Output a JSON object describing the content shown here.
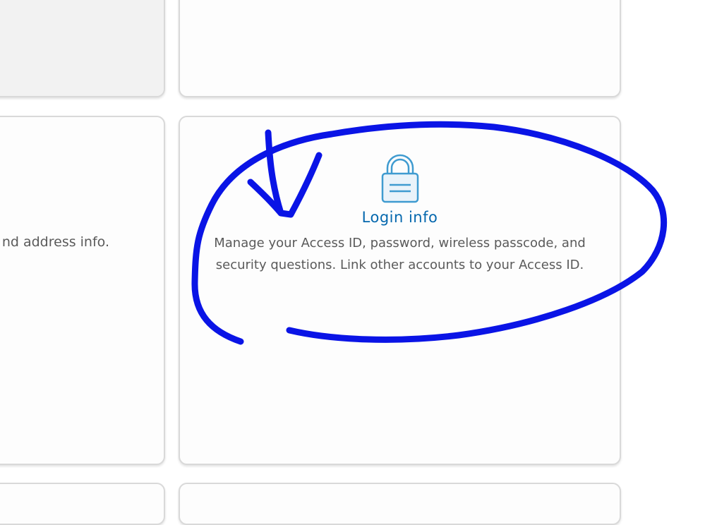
{
  "cards": {
    "address_partial_text": "nd address info.",
    "login": {
      "title": "Login info",
      "description": "Manage your Access ID, password, wireless passcode, and security questions. Link other accounts to your Access ID.",
      "icon": "lock-icon"
    }
  },
  "colors": {
    "accent": "#0568ae",
    "icon": "#3f9bd0",
    "text": "#5a5a5a",
    "annotation": "#0a14e6",
    "disabled_card": "#f2f2f2"
  }
}
